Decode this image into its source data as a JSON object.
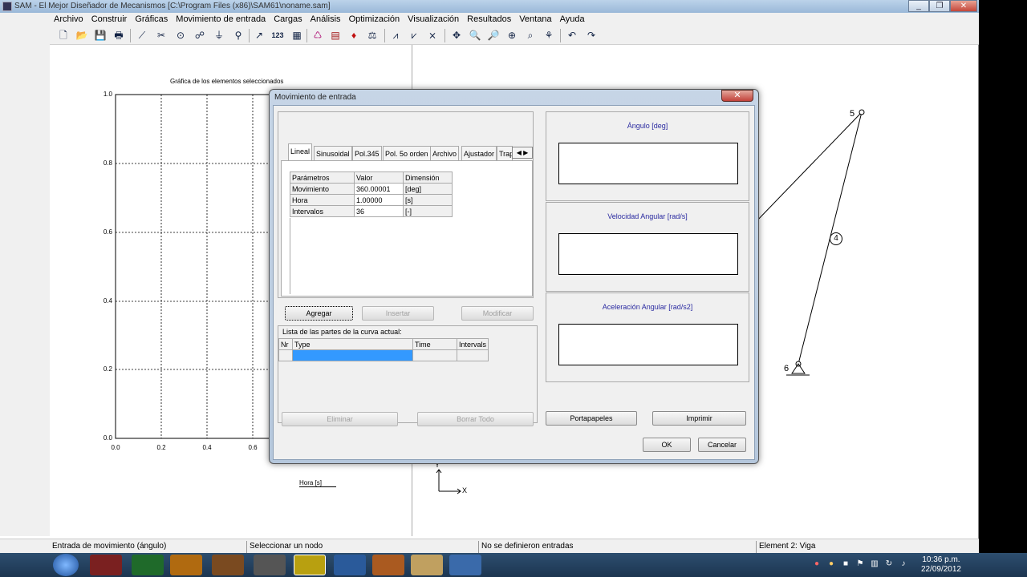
{
  "window": {
    "title": "SAM - El Mejor Diseñador de Mecanismos [C:\\Program Files (x86)\\SAM61\\noname.sam]",
    "min": "_",
    "max": "❐",
    "close": "✕"
  },
  "menu": [
    "Archivo",
    "Construir",
    "Gráficas",
    "Movimiento de entrada",
    "Cargas",
    "Análisis",
    "Optimización",
    "Visualización",
    "Resultados",
    "Ventana",
    "Ayuda"
  ],
  "toolbar_icons": {
    "new": "🗋",
    "open": "📂",
    "save": "💾",
    "print": "🖶",
    "line": "⟋",
    "cut": "✂",
    "circle": "⊙",
    "link": "☍",
    "fix": "⏚",
    "node": "⚲",
    "curve": "↗",
    "number": "123",
    "grid": "▦",
    "motor": "♺",
    "table": "▤",
    "force": "♦",
    "weight": "⚖",
    "graph1": "⩘",
    "graph2": "⩗",
    "graph3": "⨯",
    "move": "✥",
    "zoomout": "🔍",
    "zoomin": "🔎",
    "zoom": "⊕",
    "zoomfit": "⌕",
    "zoomall": "⚘",
    "undo": "↶",
    "redo": "↷"
  },
  "plot": {
    "title": "Gráfica de los elementos seleccionados",
    "xlabel": "Hora [s]",
    "yticks": [
      "1.0",
      "0.8",
      "0.6",
      "0.4",
      "0.2",
      "0.0"
    ],
    "xticks": [
      "0.0",
      "0.2",
      "0.4",
      "0.6"
    ]
  },
  "mechanism": {
    "node5": "5",
    "node6": "6",
    "element4": "4",
    "axis_x": "X",
    "axis_y": "Y"
  },
  "status": {
    "cell1": "Entrada de movimiento (ángulo)",
    "cell2": "Seleccionar un nodo",
    "cell3": "No se definieron entradas",
    "cell4": "Element 2: Viga"
  },
  "taskbar": {
    "time": "10:36 p.m.",
    "date": "22/09/2012"
  },
  "dialog": {
    "title": "Movimiento de entrada",
    "close": "✕",
    "tabs": [
      "Lineal",
      "Sinusoidal",
      "Pol.345",
      "Pol. 5o orden",
      "Archivo",
      "Ajustador",
      "Trap"
    ],
    "tab_scroll": "◀ ▶",
    "params_table": {
      "headers": [
        "Parámetros",
        "Valor",
        "Dimensión"
      ],
      "rows": [
        [
          "Movimiento",
          "360.00001",
          "[deg]"
        ],
        [
          "Hora",
          "1.00000",
          "[s]"
        ],
        [
          "Intervalos",
          "36",
          "[-]"
        ]
      ]
    },
    "buttons": {
      "agregar": "Agregar",
      "insertar": "Insertar",
      "modificar": "Modificar",
      "eliminar": "Eliminar",
      "borrar_todo": "Borrar Todo",
      "portapapeles": "Portapapeles",
      "imprimir": "Imprimir",
      "ok": "OK",
      "cancelar": "Cancelar"
    },
    "list_label": "Lista de las partes de la curva actual:",
    "list_headers": [
      "Nr",
      "Type",
      "Time",
      "Intervals"
    ],
    "right_panels": [
      "Ángulo [deg]",
      "Velocidad Angular [rad/s]",
      "Aceleración Angular [rad/s2]"
    ]
  }
}
